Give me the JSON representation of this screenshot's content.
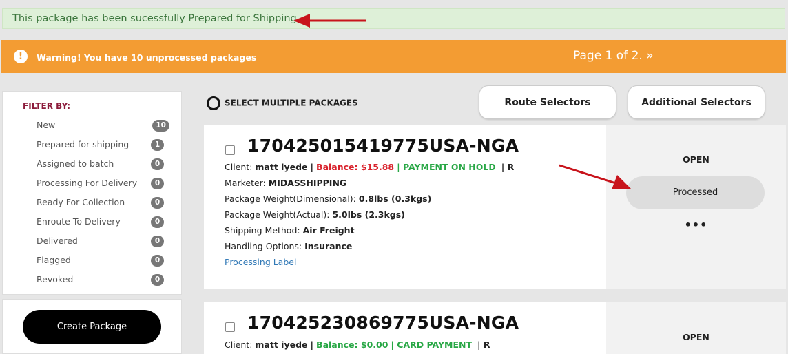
{
  "alerts": {
    "success_text": "This package has been sucessfully Prepared for Shipping.",
    "warning_text": "Warning! You have 10 unprocessed packages",
    "page_info": "Page 1 of 2.",
    "page_next": "»"
  },
  "filters": {
    "title": "FILTER BY:",
    "items": [
      {
        "label": "New",
        "count": "10"
      },
      {
        "label": "Prepared for shipping",
        "count": "1"
      },
      {
        "label": "Assigned to batch",
        "count": "0"
      },
      {
        "label": "Processing For Delivery",
        "count": "0"
      },
      {
        "label": "Ready For Collection",
        "count": "0"
      },
      {
        "label": "Enroute To Delivery",
        "count": "0"
      },
      {
        "label": "Delivered",
        "count": "0"
      },
      {
        "label": "Flagged",
        "count": "0"
      },
      {
        "label": "Revoked",
        "count": "0"
      }
    ]
  },
  "toolbar": {
    "select_multiple": "SELECT MULTIPLE PACKAGES",
    "route_selectors": "Route Selectors",
    "additional_selectors": "Additional Selectors"
  },
  "create_package": "Create Package",
  "packages": [
    {
      "id": "170425015419775USA-NGA",
      "client_label": "Client:",
      "client": "matt iyede",
      "sep": "|",
      "balance": "Balance: $15.88",
      "payment": "| PAYMENT ON HOLD",
      "flag": "| R",
      "marketer_label": "Marketer:",
      "marketer": "MIDASSHIPPING",
      "weight_dim_label": "Package Weight(Dimensional):",
      "weight_dim": "0.8lbs (0.3kgs)",
      "weight_act_label": "Package Weight(Actual):",
      "weight_act": "5.0lbs (2.3kgs)",
      "method_label": "Shipping Method:",
      "method": "Air Freight",
      "handling_label": "Handling Options:",
      "handling": "Insurance",
      "label_link": "Processing Label",
      "status": "OPEN",
      "action": "Processed",
      "more": "•••"
    },
    {
      "id": "170425230869775USA-NGA",
      "client_label": "Client:",
      "client": "matt iyede",
      "sep": "|",
      "balance": "Balance: $0.00",
      "payment": "| CARD PAYMENT",
      "flag": "| R",
      "status": "OPEN"
    }
  ],
  "colors": {
    "success_bg": "#def0d8",
    "warning_bg": "#f39c33",
    "balance_due": "#d9232d",
    "paid": "#28a745",
    "arrow": "#c8141c"
  }
}
